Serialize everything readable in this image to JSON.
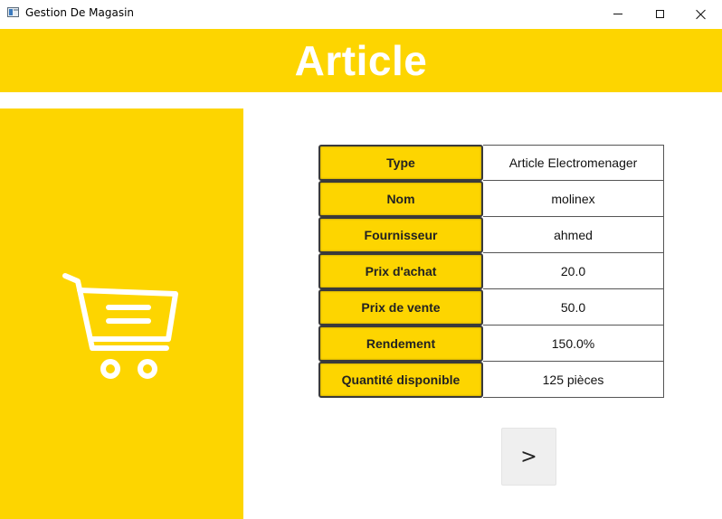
{
  "window": {
    "title": "Gestion De Magasin",
    "controls": [
      "minimize",
      "maximize",
      "close"
    ]
  },
  "header": {
    "title": "Article",
    "background_color": "#fdd500"
  },
  "left_panel": {
    "icon": "shopping-cart-icon",
    "background_color": "#fdd500"
  },
  "article": {
    "rows": [
      {
        "label": "Type",
        "value": "Article Electromenager"
      },
      {
        "label": "Nom",
        "value": "molinex"
      },
      {
        "label": "Fournisseur",
        "value": "ahmed"
      },
      {
        "label": "Prix d'achat",
        "value": "20.0"
      },
      {
        "label": "Prix de vente",
        "value": "50.0"
      },
      {
        "label": "Rendement",
        "value": "150.0%"
      },
      {
        "label": "Quantité disponible",
        "value": "125 pièces"
      }
    ]
  },
  "navigation": {
    "next_label": ">"
  }
}
